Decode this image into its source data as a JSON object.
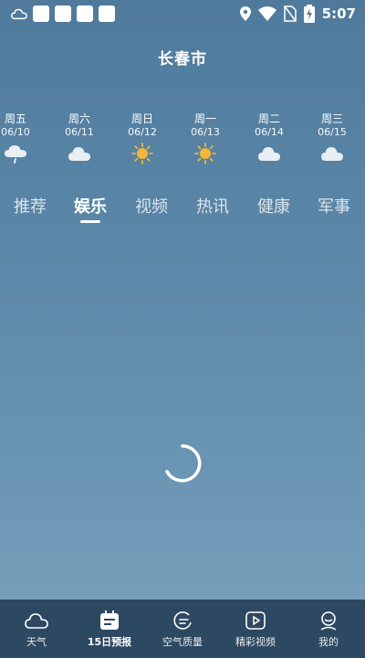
{
  "status_bar": {
    "time": "5:07",
    "icons": [
      "cloud-icon",
      "notification-icon",
      "notification-icon",
      "notification-icon",
      "notification-icon",
      "location-icon",
      "wifi-icon",
      "no-sim-icon",
      "battery-charging-icon"
    ]
  },
  "city": "长春市",
  "forecast": [
    {
      "day": "周五",
      "date": "06/10",
      "icon": "rain-cloud-icon"
    },
    {
      "day": "周六",
      "date": "06/11",
      "icon": "cloud-icon"
    },
    {
      "day": "周日",
      "date": "06/12",
      "icon": "sun-icon"
    },
    {
      "day": "周一",
      "date": "06/13",
      "icon": "sun-icon"
    },
    {
      "day": "周二",
      "date": "06/14",
      "icon": "cloud-icon"
    },
    {
      "day": "周三",
      "date": "06/15",
      "icon": "cloud-icon"
    }
  ],
  "tabs": [
    {
      "label": "推荐",
      "active": false
    },
    {
      "label": "娱乐",
      "active": true
    },
    {
      "label": "视频",
      "active": false
    },
    {
      "label": "热讯",
      "active": false
    },
    {
      "label": "健康",
      "active": false
    },
    {
      "label": "军事",
      "active": false
    }
  ],
  "bottom_nav": [
    {
      "label": "天气",
      "icon": "cloud-outline-icon",
      "active": false
    },
    {
      "label": "15日预报",
      "icon": "calendar-icon",
      "active": true
    },
    {
      "label": "空气质量",
      "icon": "air-quality-icon",
      "active": false
    },
    {
      "label": "精彩视频",
      "icon": "play-icon",
      "active": false
    },
    {
      "label": "我的",
      "icon": "user-icon",
      "active": false
    }
  ],
  "colors": {
    "nav_bg": "#2d4861",
    "sun": "#f2b73a",
    "bg_top": "#4f7a9c",
    "bg_bottom": "#7aa3be"
  }
}
